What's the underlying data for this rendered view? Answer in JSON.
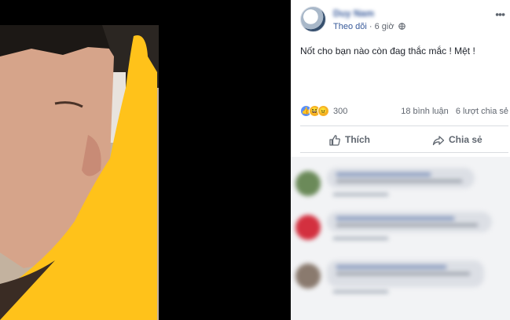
{
  "post": {
    "author": "Duy Nam",
    "follow": "Theo dõi",
    "time": "6 giờ",
    "more": "•••",
    "text": "Nốt cho bạn nào còn đag thắc mắc ! Mệt !"
  },
  "stats": {
    "reaction_count": "300",
    "comments": "18 bình luận",
    "shares": "6 lượt chia sẻ",
    "reactions": [
      "like-icon",
      "haha-icon",
      "angry-icon"
    ]
  },
  "actions": {
    "like": "Thích",
    "share": "Chia sẻ"
  },
  "colors": {
    "link": "#365899",
    "highlight_overlay": "#ffc21a",
    "panel_bg": "#ffffff"
  }
}
